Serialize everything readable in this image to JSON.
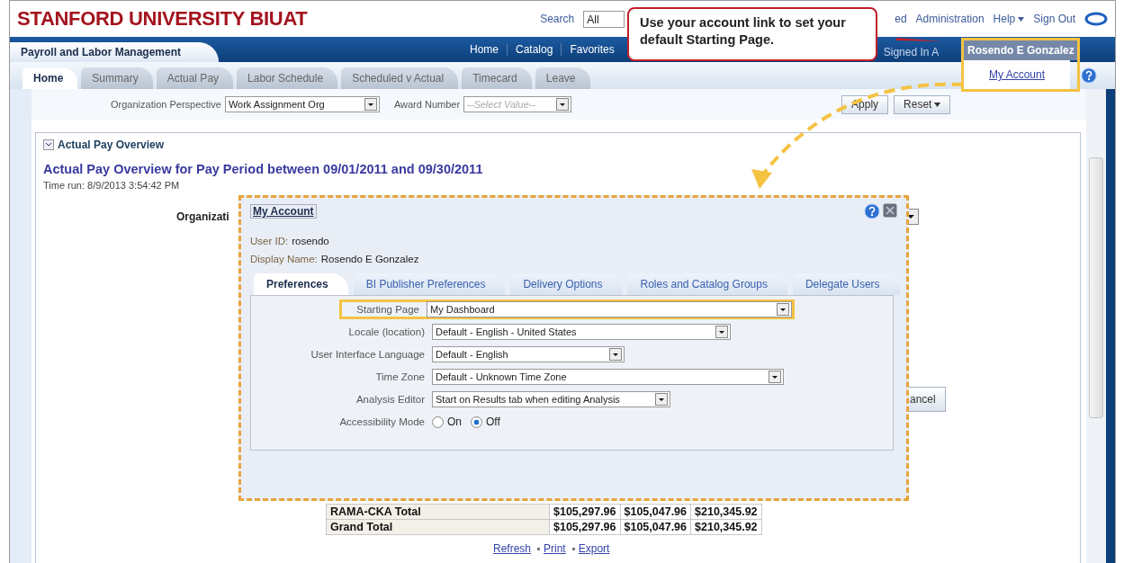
{
  "header": {
    "brand": "STANFORD UNIVERSITY BIUAT",
    "search_label": "Search",
    "search_scope": "All",
    "links": [
      {
        "label": "ed",
        "has_menu": false
      },
      {
        "label": "Administration",
        "has_menu": false
      },
      {
        "label": "Help",
        "has_menu": true
      },
      {
        "label": "Sign Out",
        "has_menu": false
      }
    ]
  },
  "app_bar": {
    "title": "Payroll and Labor Management",
    "links": [
      "Home",
      "Catalog",
      "Favorites"
    ],
    "signed_in": "Signed In A",
    "user": "Rosendo E Gonzalez",
    "user_menu": {
      "expanded": true,
      "items": [
        "My Account"
      ]
    }
  },
  "tabs": [
    {
      "label": "Home",
      "selected": true
    },
    {
      "label": "Summary",
      "selected": false
    },
    {
      "label": "Actual Pay",
      "selected": false
    },
    {
      "label": "Labor Schedule",
      "selected": false
    },
    {
      "label": "Scheduled v Actual",
      "selected": false
    },
    {
      "label": "Timecard",
      "selected": false
    },
    {
      "label": "Leave",
      "selected": false
    }
  ],
  "prompts": {
    "fields": [
      {
        "label": "Organization Perspective",
        "value": "Work Assignment Org"
      },
      {
        "label": "Award Number",
        "placeholder": "--Select Value--"
      }
    ],
    "buttons": [
      {
        "label": "Apply",
        "has_menu": false
      },
      {
        "label": "Reset",
        "has_menu": true
      }
    ]
  },
  "section": {
    "title": "Actual Pay Overview",
    "expanded": true,
    "report_title": "Actual Pay Overview for Pay Period between 09/01/2011 and 09/30/2011",
    "time_run": "Time run: 8/9/2013 3:54:42 PM",
    "prompt_label": "Organizati",
    "cancel_label": "ancel",
    "table": {
      "rows": [
        {
          "label": "RAMA-CKA Total",
          "values": [
            "$105,297.96",
            "$105,047.96",
            "$210,345.92"
          ]
        },
        {
          "label": "Grand Total",
          "values": [
            "$105,297.96",
            "$105,047.96",
            "$210,345.92"
          ]
        }
      ]
    },
    "links": [
      "Refresh",
      "Print",
      "Export"
    ]
  },
  "callout": {
    "text": "Use your account link to set your default Starting Page."
  },
  "dialog": {
    "title": "My Account",
    "user_id_label": "User ID:",
    "user_id": "rosendo",
    "display_name_label": "Display Name:",
    "display_name": "Rosendo E Gonzalez",
    "tabs": [
      {
        "label": "Preferences",
        "selected": true
      },
      {
        "label": "BI Publisher Preferences",
        "selected": false
      },
      {
        "label": "Delivery Options",
        "selected": false
      },
      {
        "label": "Roles and Catalog Groups",
        "selected": false
      },
      {
        "label": "Delegate Users",
        "selected": false
      }
    ],
    "settings": [
      {
        "label": "Starting Page",
        "kind": "select",
        "value": "My Dashboard",
        "highlighted": true
      },
      {
        "label": "Locale (location)",
        "kind": "select",
        "value": "Default - English - United States",
        "highlighted": false
      },
      {
        "label": "User Interface Language",
        "kind": "select",
        "value": "Default - English",
        "highlighted": false
      },
      {
        "label": "Time Zone",
        "kind": "select",
        "value": "Default - Unknown Time Zone",
        "highlighted": false
      },
      {
        "label": "Analysis Editor",
        "kind": "select",
        "value": "Start on Results tab when editing Analysis",
        "highlighted": false
      },
      {
        "label": "Accessibility Mode",
        "kind": "radio",
        "highlighted": false,
        "options": [
          {
            "label": "On",
            "selected": false
          },
          {
            "label": "Off",
            "selected": true
          }
        ]
      }
    ]
  }
}
